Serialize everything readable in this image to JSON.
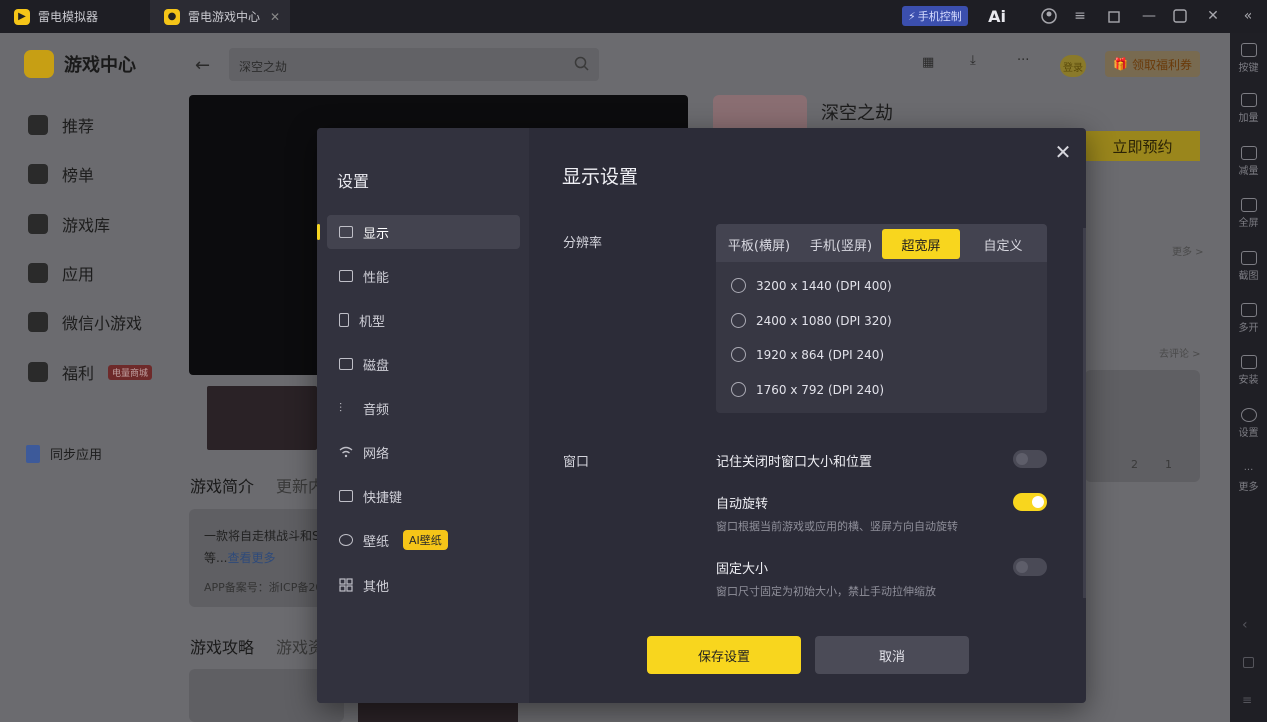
{
  "titlebar": {
    "tab1": "雷电模拟器",
    "tab2": "雷电游戏中心",
    "phone_control": "手机控制",
    "ai_label": "Ai"
  },
  "app": {
    "brand": "游戏中心",
    "search_value": "深空之劫",
    "nav": [
      "推荐",
      "榜单",
      "游戏库",
      "应用",
      "微信小游戏",
      "福利"
    ],
    "nav_badge": "电量商城",
    "sync": "同步应用",
    "login": "登录",
    "coupon": "领取福利券",
    "game_title": "深空之劫",
    "preorder": "立即预约",
    "more": "更多 >",
    "review": "去评论 >",
    "tabs_intro": [
      "游戏简介",
      "更新内"
    ],
    "intro_text": "一款将自走棋战斗和S",
    "intro_more_prefix": "等...",
    "intro_more": "查看更多",
    "icp": "APP备案号：浙ICP备20",
    "tabs_guide": [
      "游戏攻略",
      "游戏资"
    ],
    "likes": "2",
    "comments": "1"
  },
  "rightbar": [
    "按键",
    "加量",
    "减量",
    "全屏",
    "截图",
    "多开",
    "安装",
    "设置",
    "更多"
  ],
  "modal": {
    "sidebar_title": "设置",
    "menu": [
      "显示",
      "性能",
      "机型",
      "磁盘",
      "音频",
      "网络",
      "快捷键",
      "壁纸",
      "其他"
    ],
    "ai_badge": "AI壁纸",
    "heading": "显示设置",
    "resolution_label": "分辨率",
    "res_tabs": [
      "平板(横屏)",
      "手机(竖屏)",
      "超宽屏",
      "自定义"
    ],
    "res_options": [
      "3200 x 1440  (DPI 400)",
      "2400 x 1080  (DPI 320)",
      "1920 x 864  (DPI 240)",
      "1760 x 792  (DPI 240)"
    ],
    "window_label": "窗口",
    "window_opts": [
      {
        "title": "记住关闭时窗口大小和位置",
        "desc": "",
        "on": false
      },
      {
        "title": "自动旋转",
        "desc": "窗口根据当前游戏或应用的横、竖屏方向自动旋转",
        "on": true
      },
      {
        "title": "固定大小",
        "desc": "窗口尺寸固定为初始大小，禁止手动拉伸缩放",
        "on": false
      }
    ],
    "save": "保存设置",
    "cancel": "取消",
    "close_glyph": "✕"
  },
  "colors": {
    "accent": "#f8d61e",
    "modal_bg": "#2c2c38",
    "sidebar_bg": "#32323e"
  }
}
